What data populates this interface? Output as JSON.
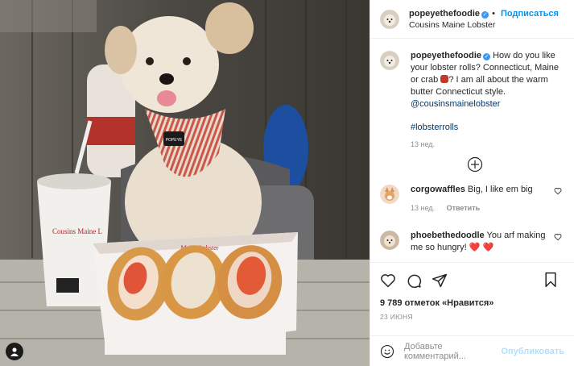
{
  "header": {
    "username": "popeyethefoodie",
    "follow_label": "Подписаться",
    "location": "Cousins Maine Lobster"
  },
  "caption": {
    "username": "popeyethefoodie",
    "text_1": "How do you like your lobster rolls? Connecticut, Maine or crab",
    "text_2": "? I am all about the warm butter Connecticut style.",
    "mention": "@cousinsmainelobster",
    "hashtag": "#lobsterrolls",
    "time": "13 нед."
  },
  "comments": [
    {
      "username": "corgowaffles",
      "text": "Big, I like em big",
      "time": "13 нед.",
      "reply_label": "Ответить"
    },
    {
      "username": "phoebethedoodle",
      "text": "You arf making me so hungry!",
      "emoji": "❤️ ❤️"
    }
  ],
  "likes": "9 789 отметок «Нравится»",
  "date": "23 ИЮНЯ",
  "composer": {
    "placeholder": "Добавьте комментарий...",
    "publish_label": "Опубликовать"
  },
  "photo": {
    "bandana_tag": "POPEYE",
    "cup_brand": "Cousins Maine L",
    "box_brand": "Maine Lobster"
  },
  "colors": {
    "accent": "#0095f6",
    "verified": "#3897f0",
    "hearts": "#ed4956"
  }
}
